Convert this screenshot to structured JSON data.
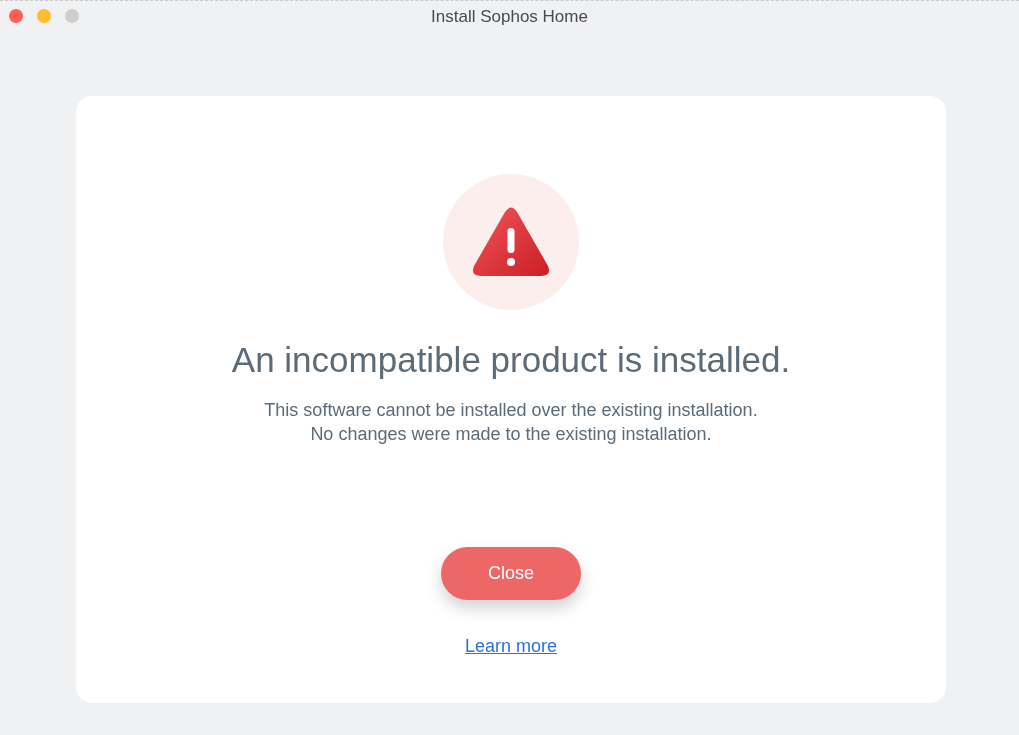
{
  "window": {
    "title": "Install Sophos Home",
    "controls": [
      {
        "color": "#fe5f57"
      },
      {
        "color": "#febc2e"
      },
      {
        "color": "#cdcdcd"
      }
    ]
  },
  "dialog": {
    "heading": "An incompatible product is installed.",
    "message": [
      "This software cannot be installed over the existing installation.",
      "No changes were made to the existing installation."
    ],
    "button": "Close",
    "link": "Learn more"
  }
}
